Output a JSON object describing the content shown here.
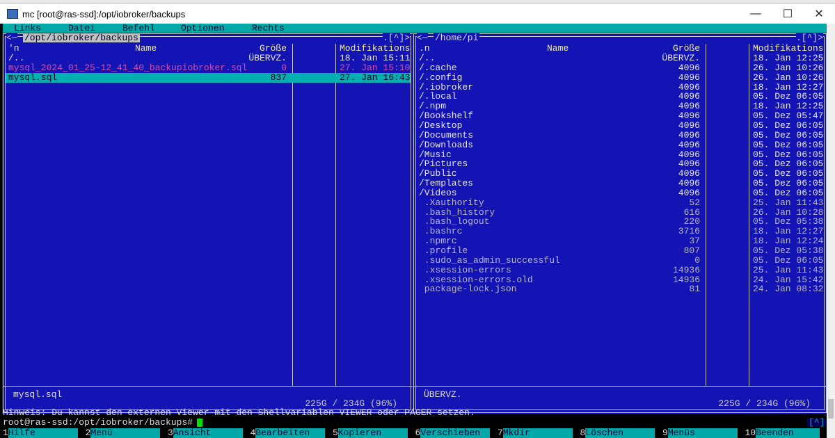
{
  "window": {
    "title": "mc [root@ras-ssd]:/opt/iobroker/backups",
    "minimize": "—",
    "maximize": "☐",
    "close": "✕"
  },
  "menu": [
    "Links",
    "Datei",
    "Befehl",
    "Optionen",
    "Rechts"
  ],
  "left": {
    "path": "/opt/iobroker/backups",
    "left_corner": "<─",
    "right_corner": ".[^]>",
    "headers": {
      "sort": "'n",
      "name": "Name",
      "size": "Größe",
      "mtime": "Modifikations"
    },
    "rows": [
      {
        "name": "/..",
        "size": "ÜBERVZ.",
        "mtime": "18. Jan 15:11",
        "type": "dir"
      },
      {
        "name": "mysql_2024_01_25-12_41_40_backupiobroker.sql",
        "size": "0",
        "mtime": "27. Jan 15:10",
        "type": "broken"
      },
      {
        "name": "mysql.sql",
        "size": "837",
        "mtime": "27. Jan 16:43",
        "type": "sel"
      }
    ],
    "mini_status": "mysql.sql",
    "free": "225G / 234G (96%)"
  },
  "right": {
    "path": "/home/pi",
    "left_corner": "<─",
    "right_corner": ".[^]>",
    "headers": {
      "sort": ".n",
      "name": "Name",
      "size": "Größe",
      "mtime": "Modifikations"
    },
    "rows": [
      {
        "name": "/..",
        "size": "ÜBERVZ.",
        "mtime": "18. Jan 12:25",
        "type": "dir"
      },
      {
        "name": "/.cache",
        "size": "4096",
        "mtime": "26. Jan 10:26",
        "type": "dir"
      },
      {
        "name": "/.config",
        "size": "4096",
        "mtime": "26. Jan 10:26",
        "type": "dir"
      },
      {
        "name": "/.iobroker",
        "size": "4096",
        "mtime": "18. Jan 12:27",
        "type": "dir"
      },
      {
        "name": "/.local",
        "size": "4096",
        "mtime": "05. Dez 06:05",
        "type": "dir"
      },
      {
        "name": "/.npm",
        "size": "4096",
        "mtime": "18. Jan 12:25",
        "type": "dir"
      },
      {
        "name": "/Bookshelf",
        "size": "4096",
        "mtime": "05. Dez 05:47",
        "type": "dir"
      },
      {
        "name": "/Desktop",
        "size": "4096",
        "mtime": "05. Dez 06:05",
        "type": "dir"
      },
      {
        "name": "/Documents",
        "size": "4096",
        "mtime": "05. Dez 06:05",
        "type": "dir"
      },
      {
        "name": "/Downloads",
        "size": "4096",
        "mtime": "05. Dez 06:05",
        "type": "dir"
      },
      {
        "name": "/Music",
        "size": "4096",
        "mtime": "05. Dez 06:05",
        "type": "dir"
      },
      {
        "name": "/Pictures",
        "size": "4096",
        "mtime": "05. Dez 06:05",
        "type": "dir"
      },
      {
        "name": "/Public",
        "size": "4096",
        "mtime": "05. Dez 06:05",
        "type": "dir"
      },
      {
        "name": "/Templates",
        "size": "4096",
        "mtime": "05. Dez 06:05",
        "type": "dir"
      },
      {
        "name": "/Videos",
        "size": "4096",
        "mtime": "05. Dez 06:05",
        "type": "dir"
      },
      {
        "name": " .Xauthority",
        "size": "52",
        "mtime": "25. Jan 11:43",
        "type": "file"
      },
      {
        "name": " .bash_history",
        "size": "616",
        "mtime": "26. Jan 10:28",
        "type": "file"
      },
      {
        "name": " .bash_logout",
        "size": "220",
        "mtime": "05. Dez 05:38",
        "type": "file"
      },
      {
        "name": " .bashrc",
        "size": "3716",
        "mtime": "18. Jan 12:27",
        "type": "file"
      },
      {
        "name": " .npmrc",
        "size": "37",
        "mtime": "18. Jan 12:24",
        "type": "file"
      },
      {
        "name": " .profile",
        "size": "807",
        "mtime": "05. Dez 05:38",
        "type": "file"
      },
      {
        "name": " .sudo_as_admin_successful",
        "size": "0",
        "mtime": "05. Dez 06:05",
        "type": "file"
      },
      {
        "name": " .xsession-errors",
        "size": "14936",
        "mtime": "25. Jan 11:43",
        "type": "file"
      },
      {
        "name": " .xsession-errors.old",
        "size": "14936",
        "mtime": "24. Jan 15:42",
        "type": "file"
      },
      {
        "name": " package-lock.json",
        "size": "81",
        "mtime": "24. Jan 08:32",
        "type": "file"
      }
    ],
    "mini_status": "ÜBERVZ.",
    "free": "225G / 234G (96%)"
  },
  "hint": "Hinweis: Du kannst den externen Viewer mit den Shellvariablen VIEWER oder PAGER setzen.",
  "prompt": "root@ras-ssd:/opt/iobroker/backups#",
  "prompt_caret": "[^]",
  "fkeys": [
    {
      "n": "1",
      "l": "Hilfe"
    },
    {
      "n": "2",
      "l": "Menü"
    },
    {
      "n": "3",
      "l": "Ansicht"
    },
    {
      "n": "4",
      "l": "Bearbeiten"
    },
    {
      "n": "5",
      "l": "Kopieren"
    },
    {
      "n": "6",
      "l": "Verschieben"
    },
    {
      "n": "7",
      "l": "Mkdir"
    },
    {
      "n": "8",
      "l": "Löschen"
    },
    {
      "n": "9",
      "l": "Menüs"
    },
    {
      "n": "10",
      "l": "Beenden"
    }
  ],
  "colors": {
    "panel_bg": "#1414b4",
    "accent": "#00a8a8",
    "broken": "#d050b0",
    "cursor": "#00e000"
  }
}
